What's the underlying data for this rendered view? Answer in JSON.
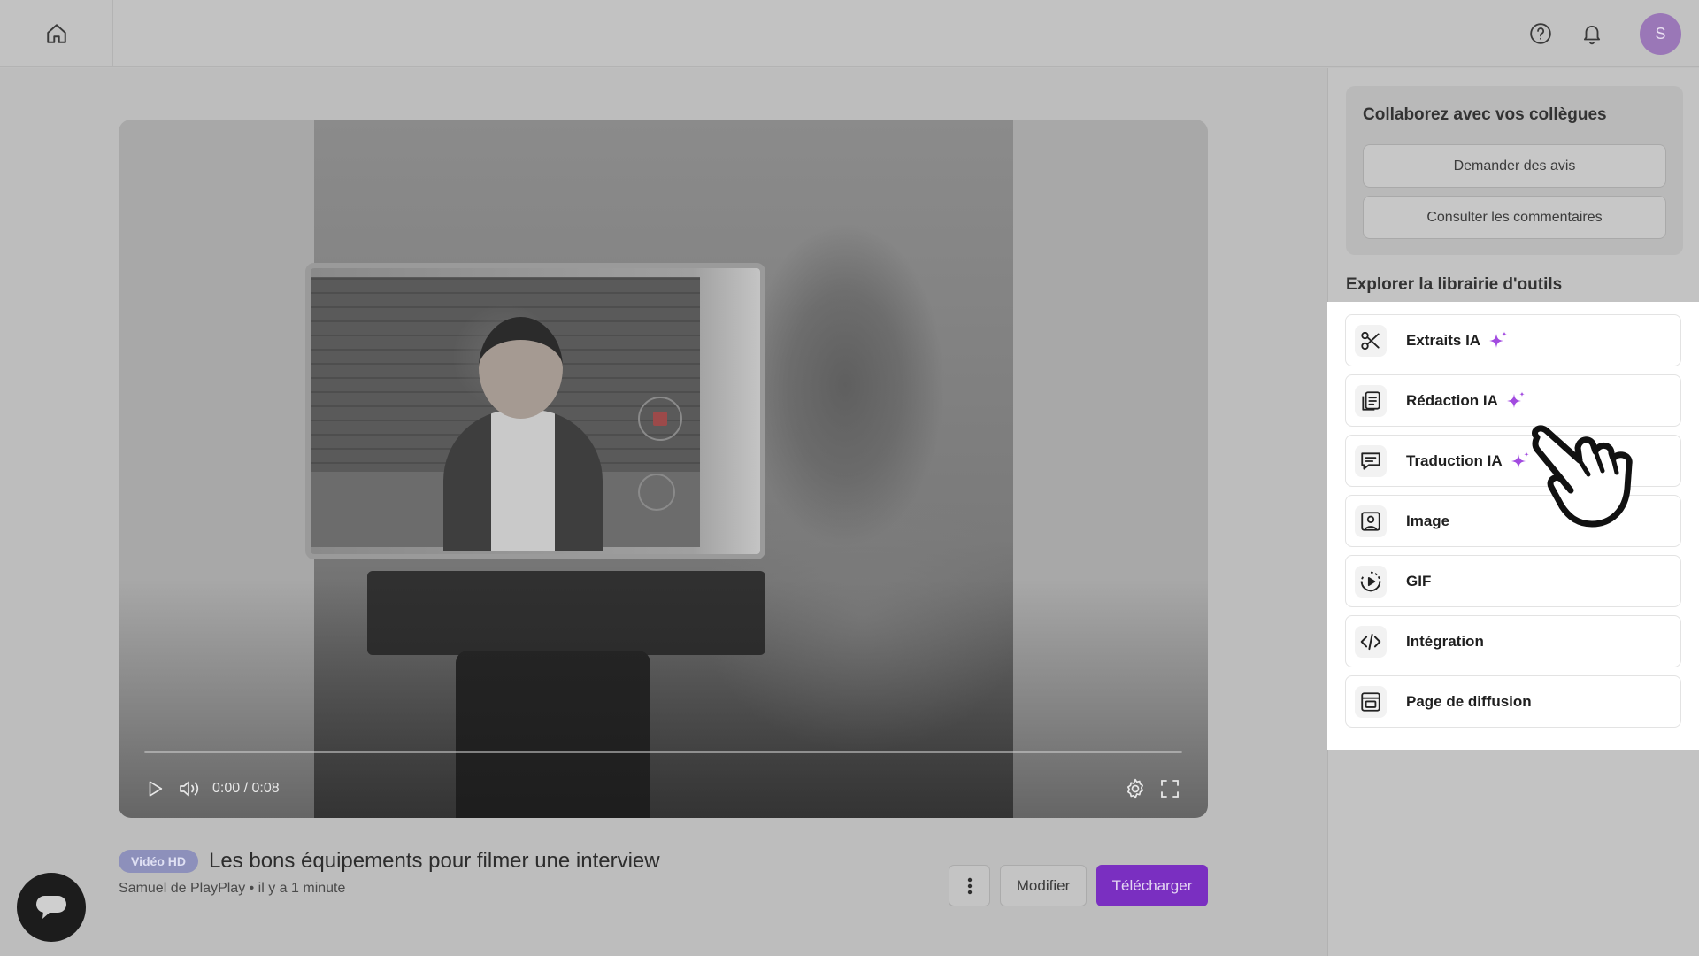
{
  "header": {
    "avatar_initial": "S"
  },
  "player": {
    "time": "0:00 / 0:08",
    "progress": 0
  },
  "video": {
    "badge": "Vidéo HD",
    "title": "Les bons équipements pour filmer une interview",
    "meta": "Samuel de PlayPlay • il y a 1 minute"
  },
  "actions": {
    "edit_label": "Modifier",
    "download_label": "Télécharger"
  },
  "sidebar": {
    "collab": {
      "title": "Collaborez avec vos collègues",
      "request_feedback": "Demander des avis",
      "view_comments": "Consulter les commentaires"
    },
    "tools_heading": "Explorer la librairie d'outils",
    "tools": [
      {
        "label": "Extraits IA",
        "icon": "scissors-icon",
        "ai": true
      },
      {
        "label": "Rédaction IA",
        "icon": "document-icon",
        "ai": true
      },
      {
        "label": "Traduction IA",
        "icon": "message-icon",
        "ai": true
      },
      {
        "label": "Image",
        "icon": "image-icon",
        "ai": false
      },
      {
        "label": "GIF",
        "icon": "play-circle-icon",
        "ai": false
      },
      {
        "label": "Intégration",
        "icon": "code-icon",
        "ai": false
      },
      {
        "label": "Page de diffusion",
        "icon": "browser-icon",
        "ai": false
      }
    ]
  },
  "colors": {
    "accent": "#7a2fc1",
    "sparkle": "#a24be0",
    "badge": "#8d90bb"
  }
}
